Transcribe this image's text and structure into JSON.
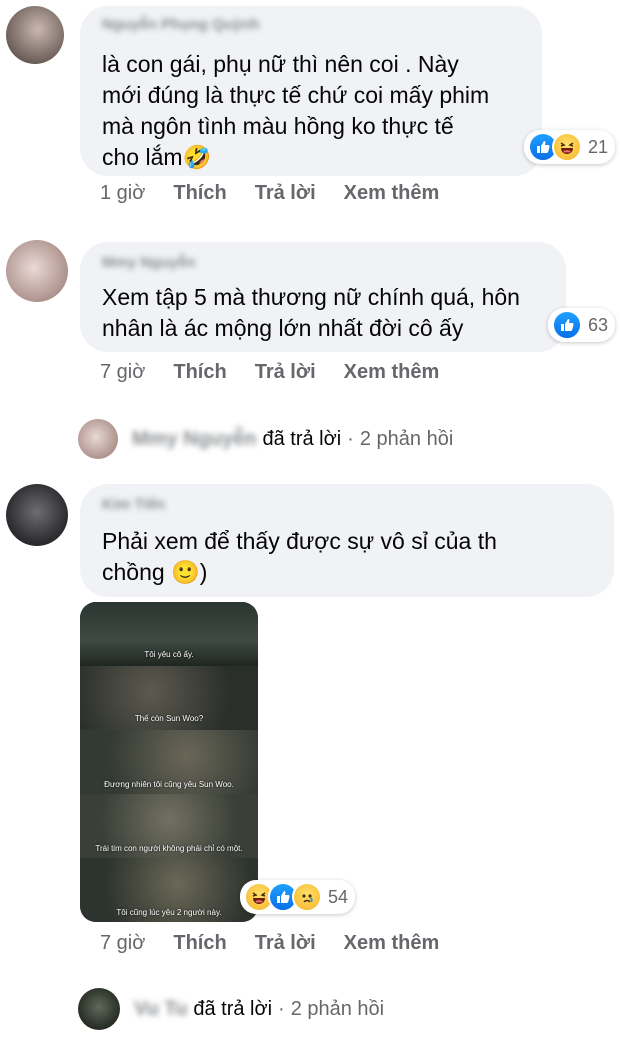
{
  "comments": [
    {
      "author": "Nguyễn Phụng Quỳnh",
      "text_lines": [
        "là con gái, phụ nữ thì nên coi . Này",
        "mới đúng là thực tế chứ coi mấy phim",
        "mà ngôn tình màu hồng ko thực tế",
        "cho lắm🤣"
      ],
      "reactions": [
        "like-icon",
        "haha-icon"
      ],
      "reaction_count": "21",
      "time": "1 giờ"
    },
    {
      "author": "Mmy Nguyễn",
      "text_lines": [
        "Xem tập 5 mà thương nữ chính quá, hôn",
        "nhân là ác mộng lớn nhất đời cô ấy"
      ],
      "reactions": [
        "like-icon"
      ],
      "reaction_count": "63",
      "time": "7 giờ",
      "reply_summary": {
        "name": "Mmy Nguyễn",
        "action": "đã trả lời",
        "count": "2 phản hồi"
      }
    },
    {
      "author": "Kim Tiến",
      "text_lines": [
        "Phải xem để thấy được sự vô sỉ của th",
        "chồng 🙂)"
      ],
      "reactions": [
        "haha-icon",
        "like-icon",
        "sad-icon"
      ],
      "reaction_count": "54",
      "time": "7 giờ",
      "image_subtitles": [
        "Tôi yêu cô ấy.",
        "Thế còn Sun Woo?",
        "Đương nhiên tôi cũng yêu Sun Woo.",
        "Trái tim con người không phải chỉ có một.",
        "Tôi cũng lúc yêu 2 người này."
      ],
      "reply_summary": {
        "name": "Vu Tu",
        "action": "đã trả lời",
        "count": "2 phản hồi"
      }
    }
  ],
  "actions": {
    "like": "Thích",
    "reply": "Trả lời",
    "more": "Xem thêm"
  },
  "separator": "·",
  "colors": {
    "bubble": "#f0f2f5",
    "meta": "#65676b",
    "like_blue": "#1877f2"
  }
}
